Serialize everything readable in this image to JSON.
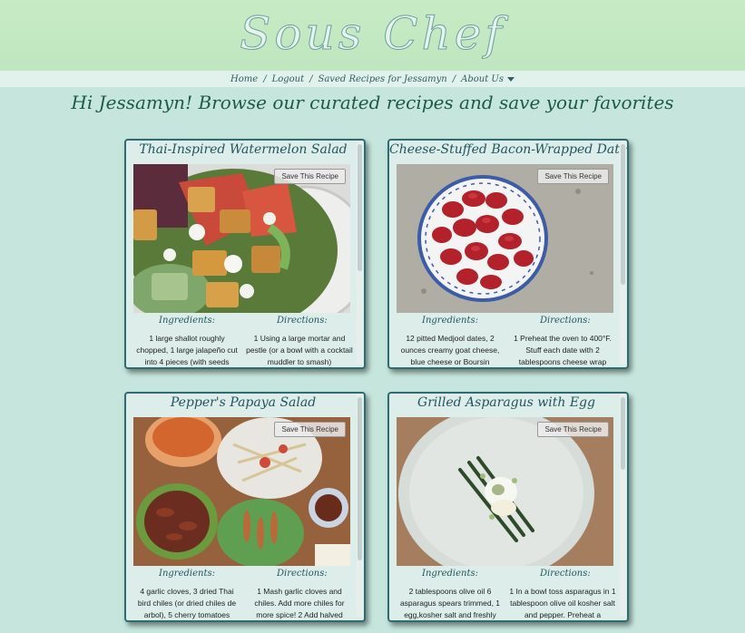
{
  "header": {
    "brand": "Sous Chef"
  },
  "nav": {
    "home": "Home",
    "logout": "Logout",
    "saved": "Saved Recipes for Jessamyn",
    "about": "About Us"
  },
  "greeting": "Hi Jessamyn! Browse our curated recipes and save your favorites",
  "labels": {
    "ingredients": "Ingredients:",
    "directions": "Directions:",
    "save": "Save This Recipe"
  },
  "recipes": [
    {
      "title": "Thai-Inspired Watermelon Salad",
      "ingredients": "1 large shallot roughly chopped, 1 large jalapeño cut into 4 pieces (with seeds",
      "directions": "1 Using a large mortar and pestle (or a bowl with a cocktail muddler to smash)"
    },
    {
      "title": "Cheese-Stuffed Bacon-Wrapped Dates",
      "ingredients": "12 pitted Medjool dates, 2 ounces creamy goat cheese, blue cheese or Boursin",
      "directions": "1 Preheat the oven to 400°F. Stuff each date with 2 tablespoons cheese wrap"
    },
    {
      "title": "Pepper's Papaya Salad",
      "ingredients": "4 garlic cloves, 3 dried Thai bird chiles (or dried chiles de arbol), 5 cherry tomatoes",
      "directions": "1 Mash garlic cloves and chiles. Add more chiles for more spice! 2 Add halved"
    },
    {
      "title": "Grilled Asparagus with Egg",
      "ingredients": "2 tablespoons olive oil 6 asparagus spears trimmed, 1 egg,kosher salt and freshly",
      "directions": "1 In a bowl toss asparagus in 1 tablespoon olive oil kosher salt and pepper. Preheat a"
    }
  ]
}
